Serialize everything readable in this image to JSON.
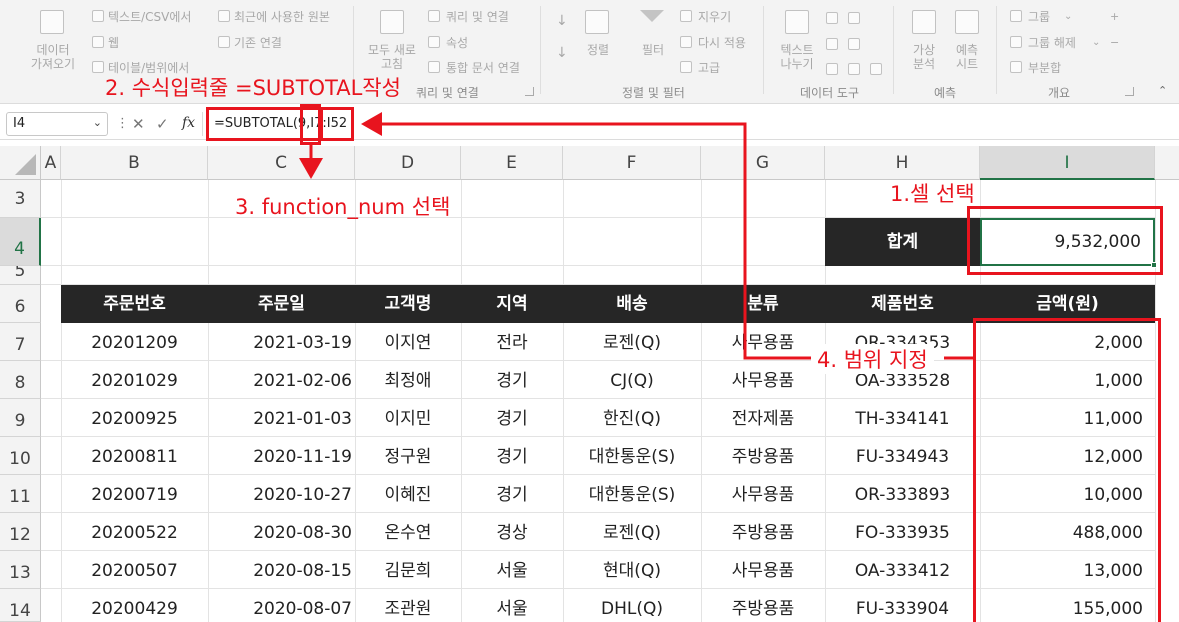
{
  "ribbon": {
    "get_data_label": [
      "데이터",
      "가져오기"
    ],
    "text_csv": "텍스트/CSV에서",
    "web": "웹",
    "table_range": "테이블/범위에서",
    "recent_sources": "최근에 사용한 원본",
    "existing_conn": "기존 연결",
    "refresh_all": [
      "모두 새로",
      "고침"
    ],
    "queries_conn": "쿼리 및 연결",
    "properties": "속성",
    "edit_links": "통합 문서 연결",
    "group_queries": "쿼리 및 연결",
    "sort_label": "정렬",
    "filter_label": "필터",
    "clear_label": "지우기",
    "reapply_label": "다시 적용",
    "advanced_label": "고급",
    "group_sort_filter": "정렬 및 필터",
    "text_to_columns": [
      "텍스트",
      "나누기"
    ],
    "group_data_tools": "데이터 도구",
    "what_if": [
      "가상",
      "분석"
    ],
    "forecast_sheet": [
      "예측",
      "시트"
    ],
    "group_forecast": "예측",
    "group_btn": "그룹",
    "ungroup_btn": "그룹 해제",
    "subtotal_btn": "부분합",
    "group_outline": "개요"
  },
  "formula_bar": {
    "name_box": "I4",
    "fx": "fx",
    "formula": "=SUBTOTAL(9,I7:I52"
  },
  "columns": [
    "A",
    "B",
    "C",
    "D",
    "E",
    "F",
    "G",
    "H",
    "I"
  ],
  "rows": [
    "3",
    "4",
    "5",
    "6",
    "7",
    "8",
    "9",
    "10",
    "11",
    "12",
    "13",
    "14"
  ],
  "summary": {
    "label": "합계",
    "value": "9,532,000"
  },
  "table": {
    "headers": [
      "주문번호",
      "주문일",
      "고객명",
      "지역",
      "배송",
      "분류",
      "제품번호",
      "금액(원)"
    ],
    "rows": [
      [
        "20201209",
        "2021-03-19",
        "이지연",
        "전라",
        "로젠(Q)",
        "사무용품",
        "OR-334353",
        "2,000"
      ],
      [
        "20201029",
        "2021-02-06",
        "최정애",
        "경기",
        "CJ(Q)",
        "사무용품",
        "OA-333528",
        "1,000"
      ],
      [
        "20200925",
        "2021-01-03",
        "이지민",
        "경기",
        "한진(Q)",
        "전자제품",
        "TH-334141",
        "11,000"
      ],
      [
        "20200811",
        "2020-11-19",
        "정구원",
        "경기",
        "대한통운(S)",
        "주방용품",
        "FU-334943",
        "12,000"
      ],
      [
        "20200719",
        "2020-10-27",
        "이혜진",
        "경기",
        "대한통운(S)",
        "사무용품",
        "OR-333893",
        "10,000"
      ],
      [
        "20200522",
        "2020-08-30",
        "온수연",
        "경상",
        "로젠(Q)",
        "주방용품",
        "FO-333935",
        "488,000"
      ],
      [
        "20200507",
        "2020-08-15",
        "김문희",
        "서울",
        "현대(Q)",
        "사무용품",
        "OA-333412",
        "13,000"
      ],
      [
        "20200429",
        "2020-08-07",
        "조관원",
        "서울",
        "DHL(Q)",
        "주방용품",
        "FU-333904",
        "155,000"
      ]
    ]
  },
  "annotations": {
    "step1": "1.셀 선택",
    "step2": "2. 수식입력줄 =SUBTOTAL작성",
    "step3": "3. function_num 선택",
    "step4": "4. 범위 지정"
  },
  "colors": {
    "accent_red": "#e8141e",
    "header_bg": "#262626",
    "excel_green": "#217346"
  }
}
